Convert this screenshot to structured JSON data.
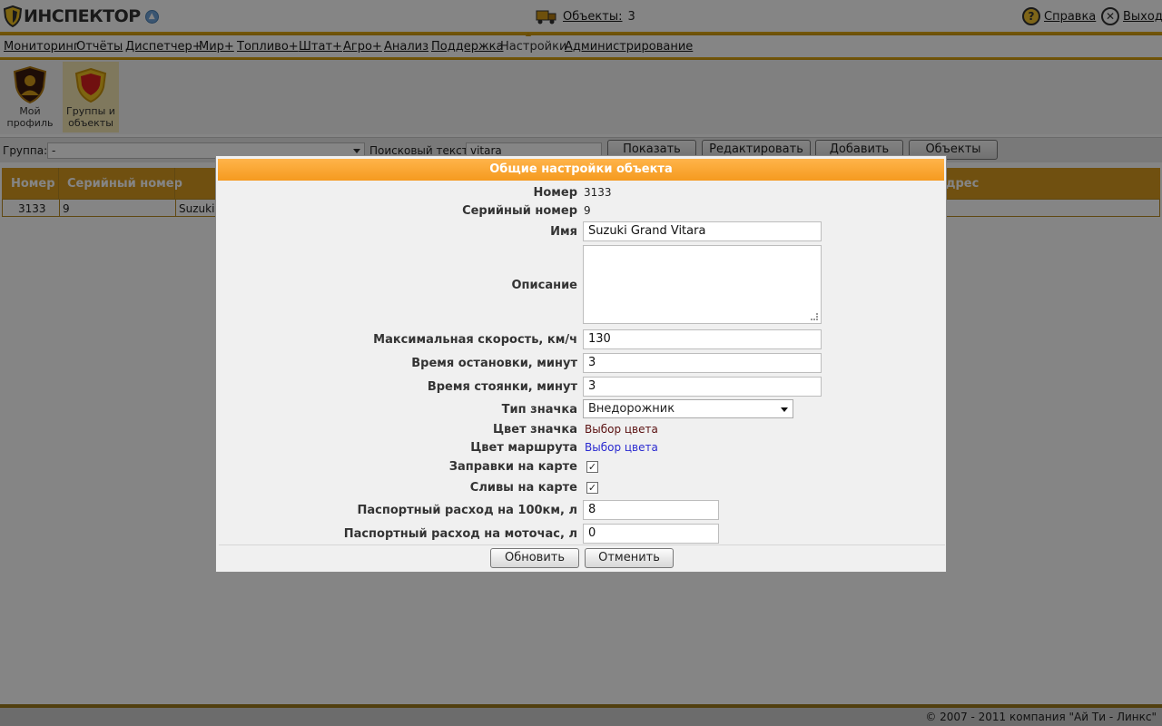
{
  "header": {
    "logo_text": "ИНСПЕКТОР",
    "objects_label": "Объекты:",
    "objects_count": "3",
    "help_label": "Справка",
    "exit_label": "Выход"
  },
  "menu": [
    {
      "label": "Мониторинг"
    },
    {
      "label": "Отчёты"
    },
    {
      "label": "Диспетчер+"
    },
    {
      "label": "Мир+"
    },
    {
      "label": "Топливо+"
    },
    {
      "label": "Штат+"
    },
    {
      "label": "Агро+"
    },
    {
      "label": "Анализ"
    },
    {
      "label": "Поддержка"
    },
    {
      "label": "Настройки"
    },
    {
      "label": "Администрирование"
    }
  ],
  "tools": [
    {
      "label_line1": "Мой",
      "label_line2": "профиль"
    },
    {
      "label_line1": "Группы и",
      "label_line2": "объекты"
    }
  ],
  "filter": {
    "group_label": "Группа:",
    "group_value": "-",
    "search_label": "Поисковый текст:",
    "search_value": "vitara",
    "show_button": "Показать",
    "edit_button": "Редактировать",
    "add_button": "Добавить",
    "objects_button": "Объекты"
  },
  "table": {
    "headers": [
      "Номер",
      "Серийный номер",
      "дрес"
    ],
    "rows": [
      {
        "number": "3133",
        "serial": "9",
        "name": "Suzuki"
      }
    ]
  },
  "dialog": {
    "title": "Общие настройки объекта",
    "number_label": "Номер",
    "number_value": "3133",
    "serial_label": "Серийный номер",
    "serial_value": "9",
    "name_label": "Имя",
    "name_value": "Suzuki Grand Vitara",
    "description_label": "Описание",
    "description_value": "",
    "max_speed_label": "Максимальная скорость, км/ч",
    "max_speed_value": "130",
    "stop_time_label": "Время остановки, минут",
    "stop_time_value": "3",
    "parking_time_label": "Время стоянки, минут",
    "parking_time_value": "3",
    "icon_type_label": "Тип значка",
    "icon_type_value": "Внедорожник",
    "icon_color_label": "Цвет значка",
    "icon_color_value": "Выбор цвета",
    "route_color_label": "Цвет маршрута",
    "route_color_value": "Выбор цвета",
    "refuels_label": "Заправки на карте",
    "refuels_checked": true,
    "drains_label": "Сливы на карте",
    "drains_checked": true,
    "fuel_100km_label": "Паспортный расход на 100км, л",
    "fuel_100km_value": "8",
    "fuel_motohour_label": "Паспортный расход на моточас, л",
    "fuel_motohour_value": "0",
    "update_button": "Обновить",
    "cancel_button": "Отменить"
  },
  "colors": {
    "accent": "#d69a20",
    "title_bar": "#f59a1f",
    "icon_color_text": "#5a1010",
    "route_color_text": "#2a2ad0"
  },
  "footer": {
    "copyright": "© 2007 - 2011 компания \"Ай Ти - Линкс\""
  }
}
